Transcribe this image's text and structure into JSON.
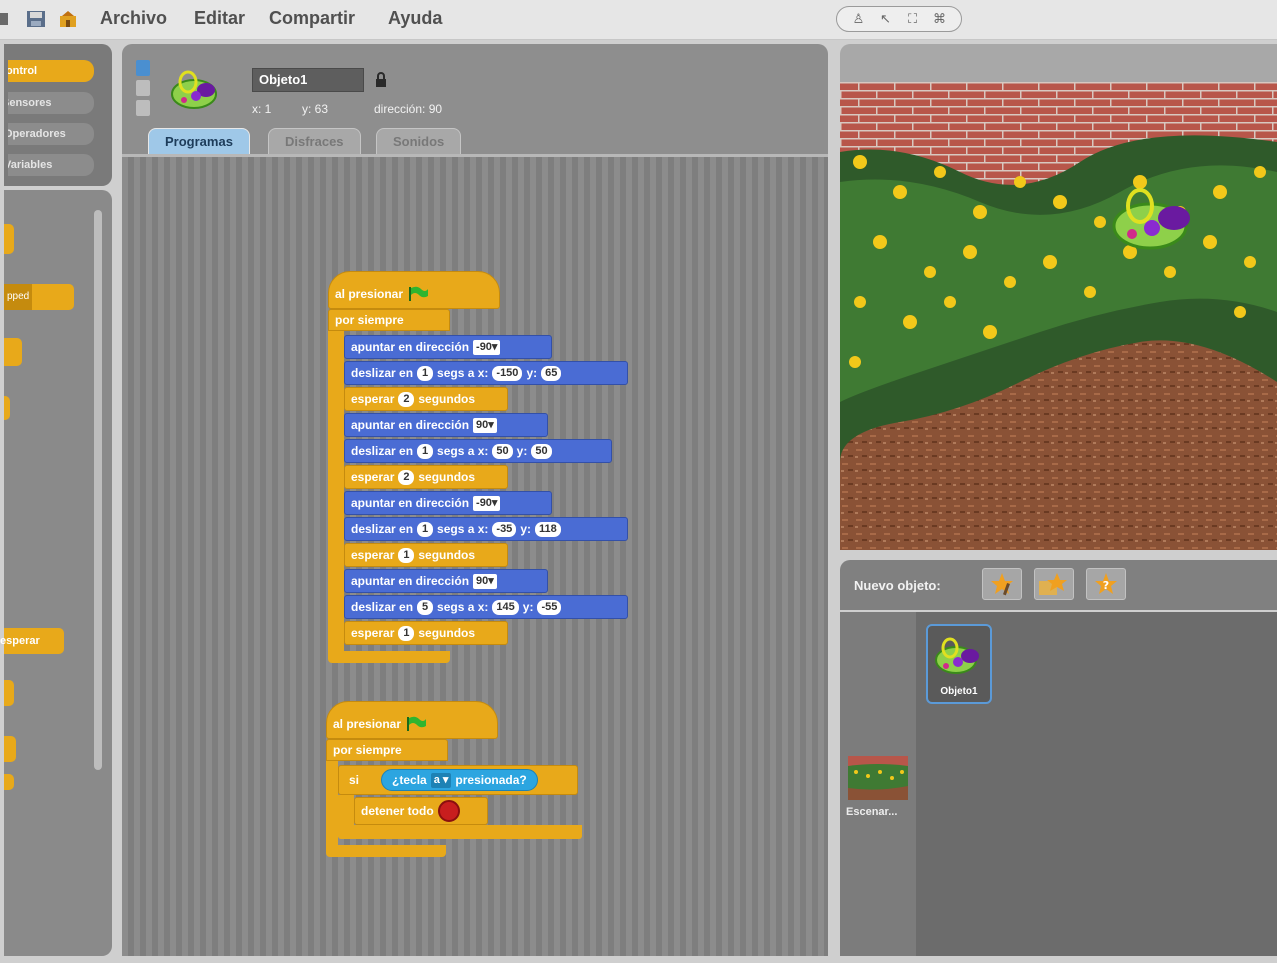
{
  "menu": {
    "items": [
      "Archivo",
      "Editar",
      "Compartir",
      "Ayuda"
    ]
  },
  "categories": [
    "Control",
    "Sensores",
    "Operadores",
    "Variables"
  ],
  "palette": {
    "visible_labels": [
      "pped",
      "esperar"
    ]
  },
  "sprite": {
    "name": "Objeto1",
    "x_label": "x: 1",
    "y_label": "y: 63",
    "direction_label": "dirección: 90"
  },
  "tabs": [
    "Programas",
    "Disfraces",
    "Sonidos"
  ],
  "script1": {
    "hat_label": "al presionar",
    "forever_label": "por siempre",
    "point_label": "apuntar en dirección",
    "glide_label": "deslizar en",
    "glide_secs": "segs a x:",
    "y_label": "y:",
    "wait_label": "esperar",
    "wait_units": "segundos",
    "steps": [
      {
        "type": "point",
        "dir": "-90▾"
      },
      {
        "type": "glide",
        "secs": "1",
        "x": "-150",
        "y": "65"
      },
      {
        "type": "wait",
        "secs": "2"
      },
      {
        "type": "point",
        "dir": "90▾"
      },
      {
        "type": "glide",
        "secs": "1",
        "x": "50",
        "y": "50"
      },
      {
        "type": "wait",
        "secs": "2"
      },
      {
        "type": "point",
        "dir": "-90▾"
      },
      {
        "type": "glide",
        "secs": "1",
        "x": "-35",
        "y": "118"
      },
      {
        "type": "wait",
        "secs": "1"
      },
      {
        "type": "point",
        "dir": "90▾"
      },
      {
        "type": "glide",
        "secs": "5",
        "x": "145",
        "y": "-55"
      },
      {
        "type": "wait",
        "secs": "1"
      }
    ]
  },
  "script2": {
    "hat_label": "al presionar",
    "forever_label": "por siempre",
    "if_label": "si",
    "key_label": "¿tecla",
    "key_value": "a ▾",
    "pressed_label": "presionada?",
    "stop_label": "detener todo"
  },
  "new_sprite": {
    "label": "Nuevo objeto:"
  },
  "sprite_list": {
    "stage_label": "Escenar...",
    "sprite_label": "Objeto1"
  },
  "colors": {
    "control": "#e8a91a",
    "motion": "#4a6cd4",
    "sensing": "#2ca5e0",
    "stop": "#c81e1e"
  },
  "icons": [
    "save-icon",
    "share-icon",
    "green-flag-icon",
    "stop-sign-icon",
    "lock-icon",
    "paint-new-sprite-icon",
    "choose-sprite-icon",
    "random-sprite-icon"
  ]
}
